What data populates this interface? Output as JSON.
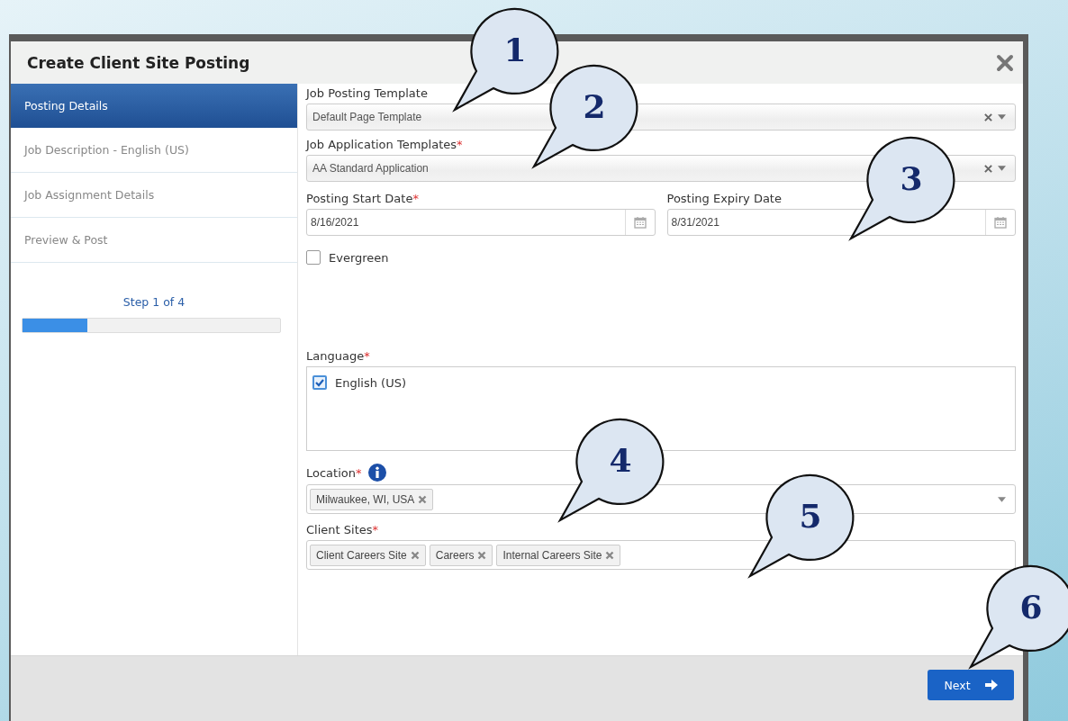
{
  "dialog": {
    "title": "Create Client Site Posting"
  },
  "steps": [
    {
      "label": "Posting Details",
      "selected": true
    },
    {
      "label": "Job Description - English (US)",
      "selected": false
    },
    {
      "label": "Job Assignment Details",
      "selected": false
    },
    {
      "label": "Preview & Post",
      "selected": false
    }
  ],
  "progress": {
    "text": "Step 1 of 4",
    "level": 0.25
  },
  "job_posting_template": {
    "label": "Job Posting Template",
    "value": "Default Page Template"
  },
  "job_application_templates": {
    "label": "Job Application Templates",
    "required_mark": "*",
    "value": "AA Standard Application"
  },
  "posting_start_date": {
    "label": "Posting Start Date",
    "required_mark": "*",
    "value": "8/16/2021"
  },
  "posting_expiry_date": {
    "label": "Posting Expiry Date",
    "value": "8/31/2021"
  },
  "evergreen": {
    "label": "Evergreen",
    "checked": false
  },
  "language": {
    "label": "Language",
    "required_mark": "*",
    "options": [
      {
        "label": "English (US)",
        "checked": true
      }
    ]
  },
  "location": {
    "label": "Location",
    "required_mark": "*",
    "tags": [
      "Milwaukee, WI, USA"
    ]
  },
  "client_sites": {
    "label": "Client Sites",
    "required_mark": "*",
    "tags": [
      "Client Careers Site",
      "Careers",
      "Internal Careers Site"
    ]
  },
  "next_button": {
    "label": "Next"
  },
  "callouts": [
    "1",
    "2",
    "3",
    "4",
    "5",
    "6"
  ]
}
